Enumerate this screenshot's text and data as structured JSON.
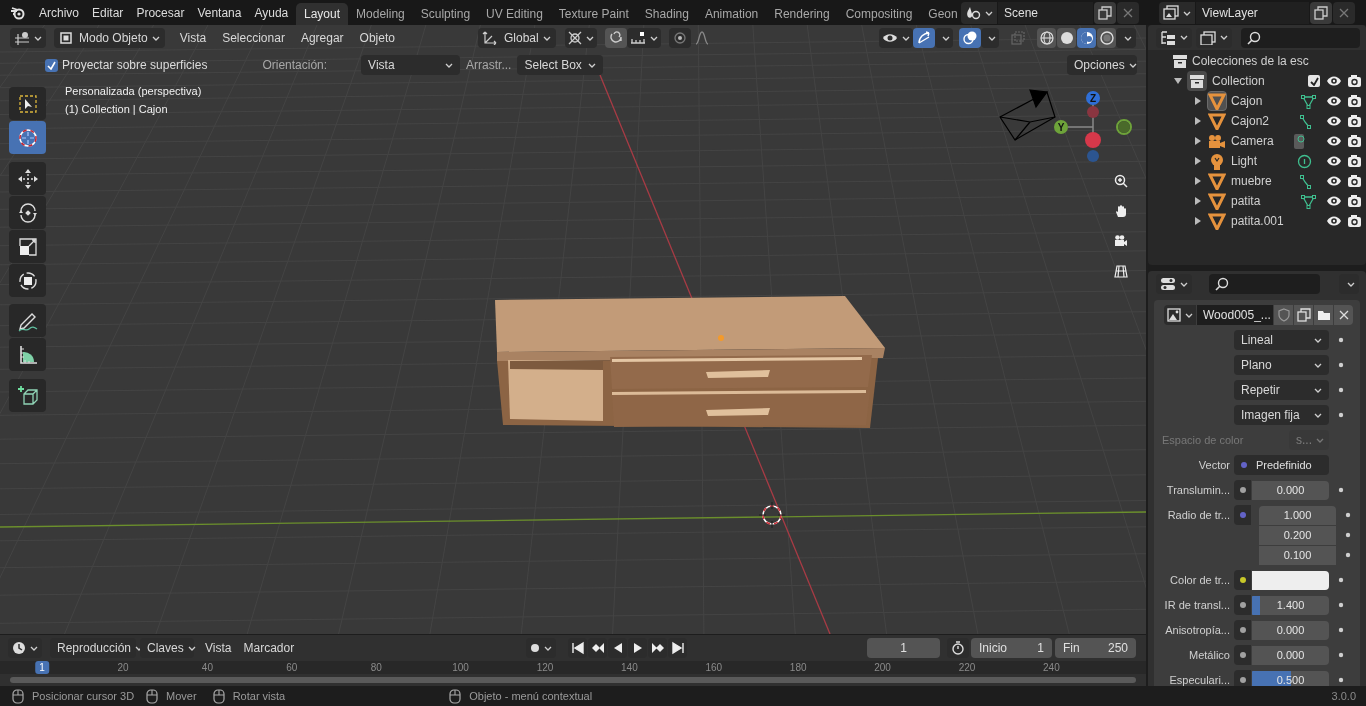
{
  "menu": [
    "Archivo",
    "Editar",
    "Procesar",
    "Ventana",
    "Ayuda"
  ],
  "workspaces": [
    {
      "label": "Layout",
      "selected": true
    },
    {
      "label": "Modeling",
      "selected": false
    },
    {
      "label": "Sculpting",
      "selected": false
    },
    {
      "label": "UV Editing",
      "selected": false
    },
    {
      "label": "Texture Paint",
      "selected": false
    },
    {
      "label": "Shading",
      "selected": false
    },
    {
      "label": "Animation",
      "selected": false
    },
    {
      "label": "Rendering",
      "selected": false
    },
    {
      "label": "Compositing",
      "selected": false
    },
    {
      "label": "Geon",
      "selected": false
    }
  ],
  "scene": "Scene",
  "view_layer": "ViewLayer",
  "viewport_header": {
    "mode": "Modo Objeto",
    "menus": [
      "Vista",
      "Seleccionar",
      "Agregar",
      "Objeto"
    ],
    "orientation": "Global",
    "gizmos_on": true,
    "overlays_on": true,
    "shading": [
      {
        "kind": "wireframe",
        "selected": false
      },
      {
        "kind": "solid",
        "selected": false
      },
      {
        "kind": "material",
        "selected": true
      },
      {
        "kind": "rendered",
        "selected": false
      }
    ]
  },
  "tool_settings": {
    "project_label": "Proyectar sobre superficies",
    "project_checked": true,
    "orientation_label": "Orientación:",
    "orientation": "Vista",
    "drag_label": "Arrastr...",
    "drag": "Select Box",
    "options": "Opciones"
  },
  "viewport_info": [
    "Personalizada (perspectiva)",
    "(1) Collection | Cajon"
  ],
  "tools": [
    {
      "kind": "select",
      "selected": false
    },
    {
      "kind": "cursor",
      "selected": true
    },
    {
      "kind": "move",
      "selected": false
    },
    {
      "kind": "rotate",
      "selected": false
    },
    {
      "kind": "scale",
      "selected": false
    },
    {
      "kind": "transform",
      "selected": false
    },
    {
      "kind": "annotate",
      "selected": false
    },
    {
      "kind": "measure",
      "selected": false
    },
    {
      "kind": "add_cube",
      "selected": false
    }
  ],
  "gizmo_labels": [
    "Z",
    "Y"
  ],
  "outliner": {
    "root": "Colecciones de la esc",
    "collection": {
      "name": "Collection",
      "checked": true,
      "expanded": true,
      "children": [
        {
          "name": "Cajon",
          "kind": "mesh",
          "data": {
            "kind": "mesh"
          },
          "selected": true
        },
        {
          "name": "Cajon2",
          "kind": "mesh",
          "data": {
            "kind": "curve"
          },
          "selected": false
        },
        {
          "name": "Camera",
          "kind": "camera",
          "data": {
            "kind": "camera"
          },
          "selected": false
        },
        {
          "name": "Light",
          "kind": "light",
          "data": {
            "kind": "light"
          },
          "selected": false
        },
        {
          "name": "muebre",
          "kind": "mesh",
          "data": {
            "kind": "curve"
          },
          "selected": false
        },
        {
          "name": "patita",
          "kind": "mesh",
          "data": {
            "kind": "mesh"
          },
          "selected": false
        },
        {
          "name": "patita.001",
          "kind": "mesh",
          "selected": false
        }
      ]
    }
  },
  "properties": {
    "image": "Wood005_...",
    "rows": [
      {
        "kind": "dropdown",
        "value": "Lineal"
      },
      {
        "kind": "dropdown",
        "value": "Plano"
      },
      {
        "kind": "dropdown",
        "value": "Repetir"
      },
      {
        "kind": "dropdown",
        "value": "Imagen fija"
      },
      {
        "kind": "small_dropdown",
        "label": "Espacio de color",
        "value": "s...",
        "disabled": true
      },
      {
        "kind": "link",
        "label": "Vector",
        "socket": {
          "color": "#6363c7"
        },
        "value": "Predefinido"
      },
      {
        "kind": "number",
        "label": "Translumin...",
        "socket": {
          "color": "#a1a1a1"
        },
        "values": [
          "0.000"
        ]
      },
      {
        "kind": "number",
        "label": "Radio de tr...",
        "socket": {
          "color": "#6363c7"
        },
        "values": [
          "1.000",
          "0.200",
          "0.100"
        ]
      },
      {
        "kind": "color",
        "label": "Color de tr...",
        "socket": {
          "color": "#c7c729"
        },
        "color": "#eeeeee"
      },
      {
        "kind": "number",
        "label": "IR de transl...",
        "socket": {
          "color": "#a1a1a1"
        },
        "values": [
          "1.400"
        ],
        "level": 0.1
      },
      {
        "kind": "number",
        "label": "Anisotropía...",
        "socket": {
          "color": "#a1a1a1"
        },
        "values": [
          "0.000"
        ]
      },
      {
        "kind": "number",
        "label": "Metálico",
        "socket": {
          "color": "#a1a1a1"
        },
        "values": [
          "0.000"
        ]
      },
      {
        "kind": "number",
        "label": "Especulari...",
        "socket": {
          "color": "#a1a1a1"
        },
        "values": [
          "0.500"
        ],
        "level": 0.5
      }
    ]
  },
  "timeline": {
    "menus": [
      "Reproducción",
      "Claves",
      "Vista",
      "Marcador"
    ],
    "current": "1",
    "start_label": "Inicio",
    "start": "1",
    "end_label": "Fin",
    "end": "250",
    "ruler": [
      "1",
      "20",
      "40",
      "60",
      "80",
      "100",
      "120",
      "140",
      "160",
      "180",
      "200",
      "220",
      "240"
    ]
  },
  "status": [
    "Posicionar cursor 3D",
    "Mover",
    "Rotar vista",
    "Objeto - menú contextual"
  ],
  "version": "3.0.0"
}
